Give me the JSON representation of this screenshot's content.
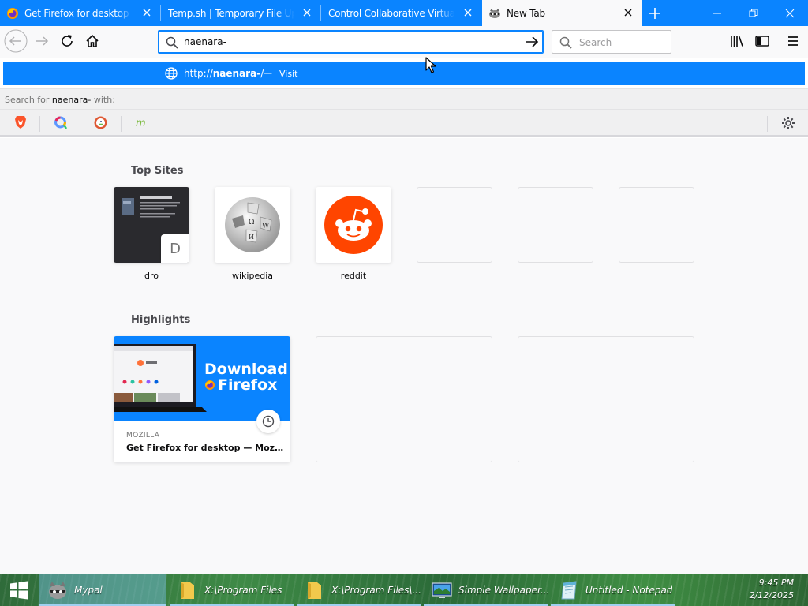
{
  "browser": {
    "tabs": [
      {
        "title": "Get Firefox for desktop — Mozilla",
        "icon": "firefox-icon",
        "selected": false
      },
      {
        "title": "Temp.sh | Temporary File Upload",
        "icon": "none",
        "selected": false
      },
      {
        "title": "Control Collaborative Virtual Machine",
        "icon": "none",
        "selected": false
      },
      {
        "title": "New Tab",
        "icon": "raccoon-icon",
        "selected": true
      }
    ],
    "url_input": "naenara-",
    "search_placeholder": "Search"
  },
  "dropdown": {
    "visit_scheme": "http://",
    "visit_host": "naenara-",
    "visit_path": "/",
    "visit_dash": "—",
    "visit_label": "Visit",
    "search_for_prefix": "Search for",
    "search_for_term": "naenara-",
    "search_for_suffix": "with:",
    "engines": [
      {
        "name": "brave-search",
        "color": "#fb542b"
      },
      {
        "name": "qwant",
        "color": "#5c97ff"
      },
      {
        "name": "duckduckgo",
        "color": "#de5833"
      },
      {
        "name": "mojeek",
        "color": "#7ab93d"
      }
    ]
  },
  "newtab": {
    "top_sites_title": "Top Sites",
    "top_sites": [
      {
        "label": "dro",
        "letter": "D"
      },
      {
        "label": "wikipedia"
      },
      {
        "label": "reddit"
      },
      {
        "label": ""
      },
      {
        "label": ""
      },
      {
        "label": ""
      }
    ],
    "highlights_title": "Highlights",
    "highlights": [
      {
        "source": "MOZILLA",
        "title": "Get Firefox for desktop — Mozilla (US)",
        "image_text_1": "Download",
        "image_text_2": "Firefox"
      }
    ]
  },
  "taskbar": {
    "items": [
      {
        "label": "Mypal",
        "active": true
      },
      {
        "label": "X:\\Program Files",
        "active": false
      },
      {
        "label": "X:\\Program Files\\...",
        "active": false
      },
      {
        "label": "Simple Wallpaper...",
        "active": false
      },
      {
        "label": "Untitled - Notepad",
        "active": false
      }
    ],
    "time": "9:45 PM",
    "date": "2/12/2025"
  },
  "colors": {
    "accent": "#0a84ff",
    "reddit": "#ff4500"
  }
}
